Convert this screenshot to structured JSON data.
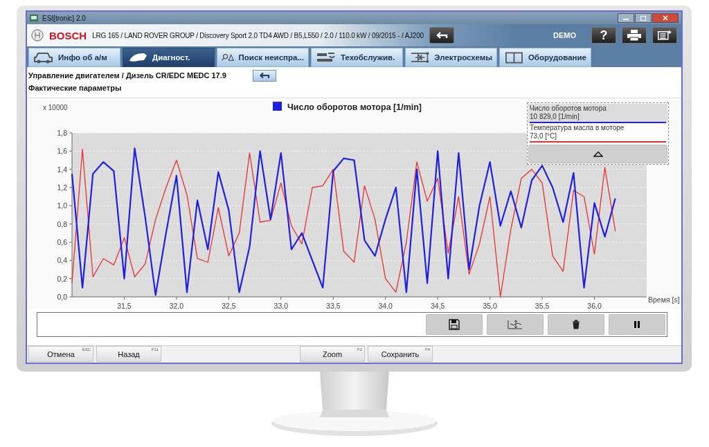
{
  "window": {
    "title": "ESI[tronic] 2.0"
  },
  "header": {
    "logo": "BOSCH",
    "vehicle": "LRG 165 / LAND ROVER GROUP / Discovery Sport 2.0 TD4 AWD / B5,L550 / 2.0 / 110.0 kW / 09/2015 - / AJ200",
    "mode": "DEMO",
    "help": "?"
  },
  "tabs": [
    {
      "label": "Инфо об а/м",
      "selected": false
    },
    {
      "label": "Диагност.",
      "selected": true
    },
    {
      "label": "Поиск неиспра...",
      "selected": false
    },
    {
      "label": "Техобслужив.",
      "selected": false
    },
    {
      "label": "Электросхемы",
      "selected": false
    },
    {
      "label": "Оборудование",
      "selected": false
    }
  ],
  "breadcrumb": "Управление двигателем / Дизель CR/EDC MEDC 17.9",
  "subtitle": "Фактические параметры",
  "chart": {
    "chart_data": {
      "type": "line",
      "title": "Число оборотов мотора [1/min]",
      "xlabel": "Время [s]",
      "ylabel": "x 10000",
      "x": [
        31.0,
        31.1,
        31.2,
        31.3,
        31.4,
        31.5,
        31.6,
        31.7,
        31.8,
        31.9,
        32.0,
        32.1,
        32.2,
        32.3,
        32.4,
        32.5,
        32.6,
        32.7,
        32.8,
        32.9,
        33.0,
        33.1,
        33.2,
        33.3,
        33.4,
        33.5,
        33.6,
        33.7,
        33.8,
        33.9,
        34.0,
        34.1,
        34.2,
        34.3,
        34.4,
        34.5,
        34.6,
        34.7,
        34.8,
        34.9,
        35.0,
        35.1,
        35.2,
        35.3,
        35.4,
        35.5,
        35.6,
        35.7,
        35.8,
        35.9,
        36.0,
        36.1,
        36.2
      ],
      "series": [
        {
          "name": "Число оборотов мотора",
          "color": "#1f1fe0",
          "values": [
            1.35,
            0.1,
            1.35,
            1.48,
            1.38,
            0.2,
            1.63,
            0.88,
            0.02,
            0.7,
            1.33,
            0.05,
            1.06,
            0.52,
            1.37,
            0.95,
            0.05,
            0.55,
            1.6,
            0.85,
            1.58,
            0.52,
            0.7,
            0.4,
            0.1,
            1.38,
            1.52,
            1.5,
            0.62,
            0.45,
            0.85,
            1.2,
            0.05,
            1.4,
            0.15,
            1.6,
            0.2,
            1.58,
            0.3,
            1.0,
            1.48,
            0.78,
            1.16,
            0.76,
            1.28,
            1.44,
            1.2,
            0.82,
            1.36,
            0.1,
            1.03,
            0.66,
            1.08
          ]
        },
        {
          "name": "Температура масла в моторе",
          "color": "#e83030",
          "values": [
            0.15,
            1.62,
            0.22,
            0.42,
            0.35,
            0.65,
            0.22,
            0.36,
            0.85,
            1.2,
            1.5,
            1.12,
            0.42,
            0.38,
            0.98,
            0.45,
            0.7,
            1.58,
            0.82,
            0.84,
            1.25,
            0.78,
            0.58,
            1.2,
            1.22,
            1.4,
            0.5,
            0.38,
            1.22,
            0.85,
            0.2,
            0.05,
            0.6,
            1.48,
            1.05,
            1.3,
            0.48,
            1.1,
            0.25,
            0.58,
            1.1,
            0.0,
            0.74,
            1.3,
            1.4,
            1.25,
            0.45,
            0.28,
            1.17,
            1.1,
            0.47,
            1.42,
            0.72
          ]
        }
      ],
      "grid": true,
      "xlim": [
        31.0,
        36.5
      ],
      "ylim": [
        0,
        1.8
      ],
      "xticks": [
        {
          "value": 31.5,
          "label": "31,5"
        },
        {
          "value": 32.0,
          "label": "32,0"
        },
        {
          "value": 32.5,
          "label": "32,5"
        },
        {
          "value": 33.0,
          "label": "33,0"
        },
        {
          "value": 33.5,
          "label": "33,5"
        },
        {
          "value": 34.0,
          "label": "34,0"
        },
        {
          "value": 34.5,
          "label": "34,5"
        },
        {
          "value": 35.0,
          "label": "35,0"
        },
        {
          "value": 35.5,
          "label": "35,5"
        },
        {
          "value": 36.0,
          "label": "36,0"
        }
      ],
      "yticks": [
        {
          "value": 0,
          "label": "0,0"
        },
        {
          "value": 0.2,
          "label": "0,2"
        },
        {
          "value": 0.4,
          "label": "0,4"
        },
        {
          "value": 0.6,
          "label": "0,6"
        },
        {
          "value": 0.8,
          "label": "0,8"
        },
        {
          "value": 1.0,
          "label": "1,0"
        },
        {
          "value": 1.2,
          "label": "1,2"
        },
        {
          "value": 1.4,
          "label": "1,4"
        },
        {
          "value": 1.6,
          "label": "1,6"
        },
        {
          "value": 1.8,
          "label": "1,8"
        }
      ]
    }
  },
  "legend": [
    {
      "reading": "10 829,0 [1/min]",
      "selected": true
    },
    {
      "reading": "73,0 [°C]",
      "selected": false
    }
  ],
  "buttons": [
    {
      "label": "Отмена",
      "key": "ESC"
    },
    {
      "label": "Назад",
      "key": "F11"
    },
    {
      "label": "Zoom",
      "key": "F2"
    },
    {
      "label": "Сохранить",
      "key": "F4"
    }
  ]
}
